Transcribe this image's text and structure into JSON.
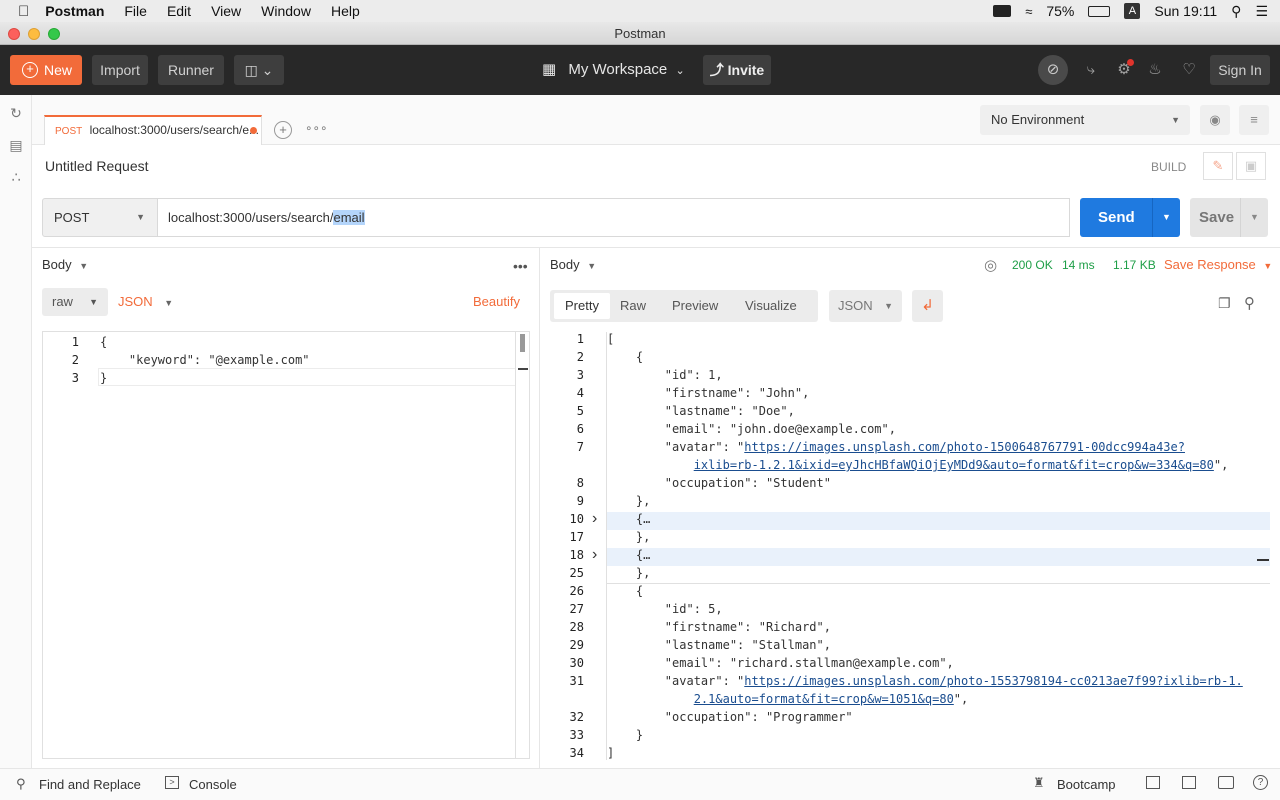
{
  "menubar": {
    "apple": "",
    "app": "Postman",
    "items": [
      "File",
      "Edit",
      "View",
      "Window",
      "Help"
    ],
    "battery": "75%",
    "keyboard": "A",
    "clock": "Sun 19:11"
  },
  "window": {
    "title": "Postman"
  },
  "toolbar": {
    "new_label": "New",
    "import_label": "Import",
    "runner_label": "Runner",
    "workspace_label": "My Workspace",
    "invite_label": "Invite",
    "signin_label": "Sign In"
  },
  "tab": {
    "method": "POST",
    "title": "localhost:3000/users/search/e..."
  },
  "environment": {
    "selected": "No Environment"
  },
  "request": {
    "name": "Untitled Request",
    "mode": "BUILD",
    "method": "POST",
    "url_prefix": "localhost:3000/users/search/",
    "url_selected": "email",
    "send_label": "Send",
    "save_label": "Save"
  },
  "body_pane": {
    "title": "Body",
    "type": "raw",
    "format": "JSON",
    "beautify": "Beautify",
    "lines": [
      {
        "n": "1",
        "text": "{"
      },
      {
        "n": "2",
        "text": "    \"keyword\": \"@example.com\""
      },
      {
        "n": "3",
        "text": "}"
      }
    ]
  },
  "response": {
    "title": "Body",
    "status": "200 OK",
    "time": "14 ms",
    "size": "1.17 KB",
    "save_response": "Save Response",
    "tabs": [
      "Pretty",
      "Raw",
      "Preview",
      "Visualize"
    ],
    "active_tab": "Pretty",
    "format": "JSON",
    "lines": [
      {
        "n": "1",
        "text": "["
      },
      {
        "n": "2",
        "text": "    {"
      },
      {
        "n": "3",
        "text": "        \"id\": 1,"
      },
      {
        "n": "4",
        "text": "        \"firstname\": \"John\","
      },
      {
        "n": "5",
        "text": "        \"lastname\": \"Doe\","
      },
      {
        "n": "6",
        "text": "        \"email\": \"john.doe@example.com\","
      },
      {
        "n": "7",
        "text": "        \"avatar\": \"",
        "link": "https://images.unsplash.com/photo-1500648767791-00dcc994a43e?",
        "after": ""
      },
      {
        "n": "",
        "text": "            ",
        "link": "ixlib=rb-1.2.1&ixid=eyJhcHBfaWQiOjEyMDd9&auto=format&fit=crop&w=334&q=80",
        "after": "\","
      },
      {
        "n": "8",
        "text": "        \"occupation\": \"Student\""
      },
      {
        "n": "9",
        "text": "    },"
      },
      {
        "n": "10",
        "text": "    {…",
        "fold": true
      },
      {
        "n": "17",
        "text": "    },"
      },
      {
        "n": "18",
        "text": "    {…",
        "fold": true
      },
      {
        "n": "25",
        "text": "    },"
      },
      {
        "n": "26",
        "text": "    {"
      },
      {
        "n": "27",
        "text": "        \"id\": 5,"
      },
      {
        "n": "28",
        "text": "        \"firstname\": \"Richard\","
      },
      {
        "n": "29",
        "text": "        \"lastname\": \"Stallman\","
      },
      {
        "n": "30",
        "text": "        \"email\": \"richard.stallman@example.com\","
      },
      {
        "n": "31",
        "text": "        \"avatar\": \"",
        "link": "https://images.unsplash.com/photo-1553798194-cc0213ae7f99?ixlib=rb-1.",
        "after": ""
      },
      {
        "n": "",
        "text": "            ",
        "link": "2.1&auto=format&fit=crop&w=1051&q=80",
        "after": "\","
      },
      {
        "n": "32",
        "text": "        \"occupation\": \"Programmer\""
      },
      {
        "n": "33",
        "text": "    }"
      },
      {
        "n": "34",
        "text": "]"
      }
    ]
  },
  "statusbar": {
    "find_replace": "Find and Replace",
    "console": "Console",
    "bootcamp": "Bootcamp"
  },
  "colors": {
    "accent": "#f26b3a",
    "send": "#1f7ae0",
    "status_ok": "#1e9e47",
    "toolbar_bg": "#282828"
  }
}
